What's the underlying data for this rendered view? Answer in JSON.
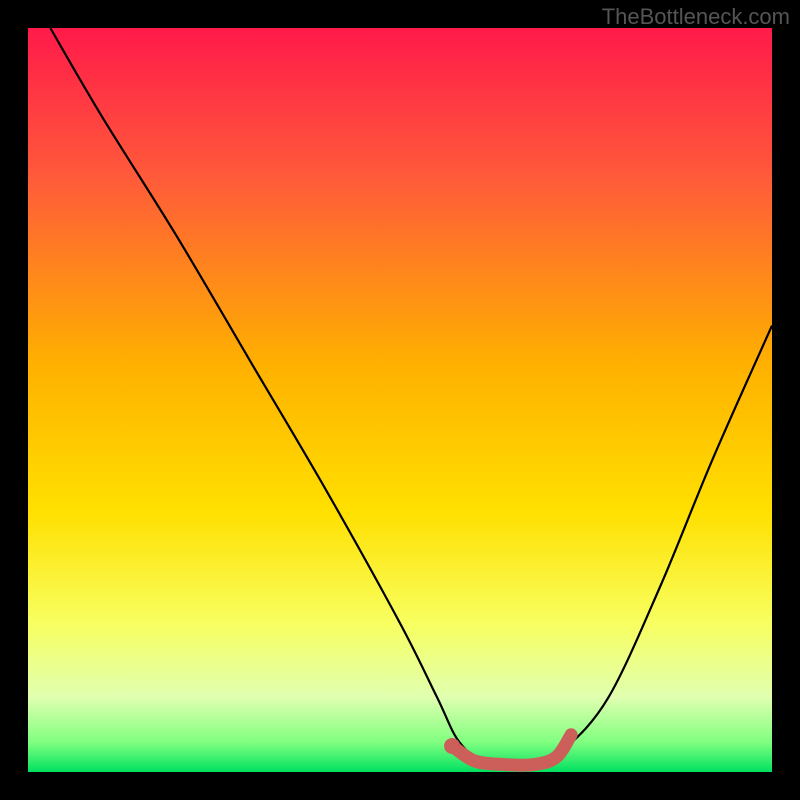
{
  "watermark": "TheBottleneck.com",
  "chart_data": {
    "type": "line",
    "title": "",
    "xlabel": "",
    "ylabel": "",
    "xlim": [
      0,
      100
    ],
    "ylim": [
      0,
      100
    ],
    "gradient_stops": [
      {
        "offset": 0.0,
        "color": "#ff1a4a"
      },
      {
        "offset": 0.2,
        "color": "#ff5a3a"
      },
      {
        "offset": 0.45,
        "color": "#ffb000"
      },
      {
        "offset": 0.65,
        "color": "#ffe000"
      },
      {
        "offset": 0.8,
        "color": "#f8ff60"
      },
      {
        "offset": 0.9,
        "color": "#e0ffb0"
      },
      {
        "offset": 0.96,
        "color": "#80ff80"
      },
      {
        "offset": 1.0,
        "color": "#00e060"
      }
    ],
    "series": [
      {
        "name": "bottleneck-curve",
        "x": [
          3,
          10,
          20,
          30,
          40,
          50,
          55,
          58,
          62,
          68,
          72,
          78,
          85,
          92,
          100
        ],
        "y": [
          100,
          88,
          72,
          55,
          38,
          20,
          10,
          4,
          1,
          1,
          3,
          10,
          25,
          42,
          60
        ]
      },
      {
        "name": "optimal-range",
        "x": [
          57,
          60,
          64,
          68,
          71,
          73
        ],
        "y": [
          3.5,
          1.5,
          1,
          1,
          2,
          5
        ]
      }
    ]
  }
}
